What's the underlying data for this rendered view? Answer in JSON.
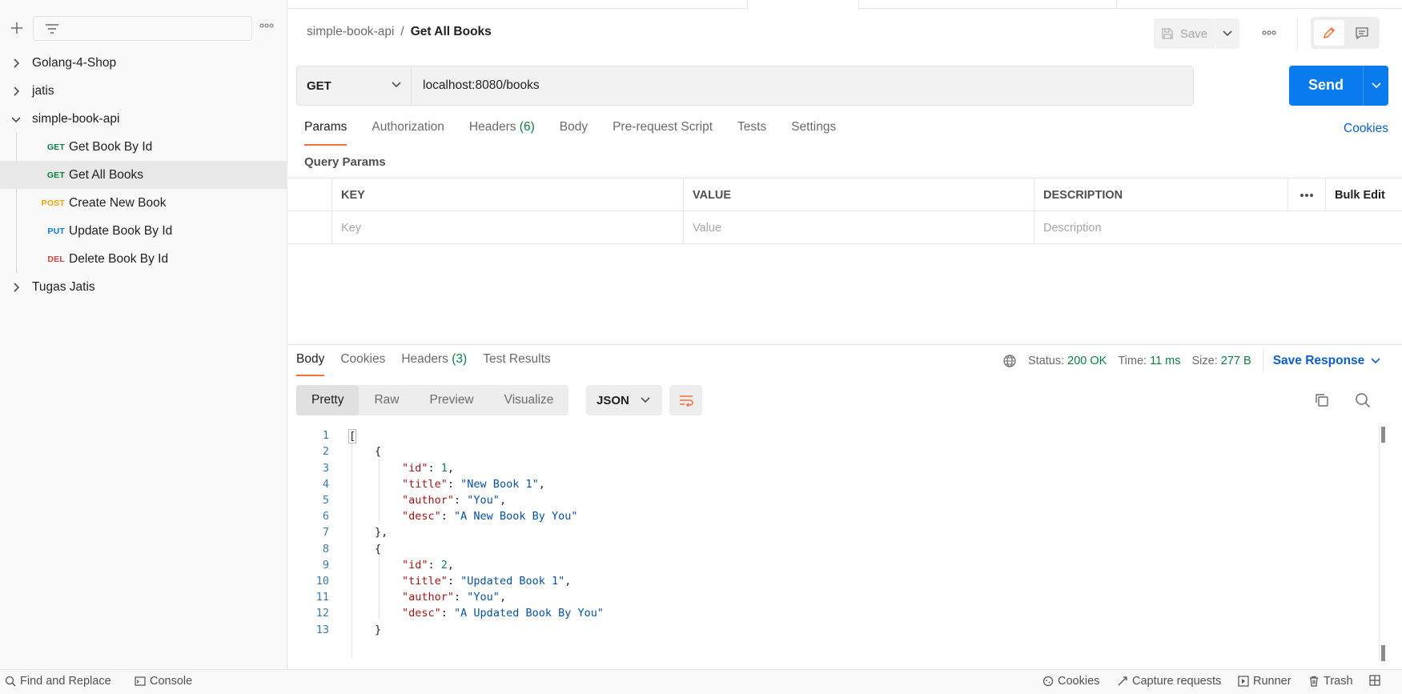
{
  "sidebar": {
    "collections": [
      {
        "label": "Golang-4-Shop"
      },
      {
        "label": "jatis"
      },
      {
        "label": "simple-book-api"
      },
      {
        "label": "Tugas Jatis"
      }
    ],
    "requests": [
      {
        "method": "GET",
        "label": "Get Book By Id",
        "color": "#0a7f3f"
      },
      {
        "method": "GET",
        "label": "Get All Books",
        "color": "#0a7f3f"
      },
      {
        "method": "POST",
        "label": "Create New Book",
        "color": "#f2a007"
      },
      {
        "method": "PUT",
        "label": "Update Book By Id",
        "color": "#097bed"
      },
      {
        "method": "DEL",
        "label": "Delete Book By Id",
        "color": "#d93f3c"
      }
    ]
  },
  "header": {
    "breadcrumb_parent": "simple-book-api",
    "breadcrumb_sep": "/",
    "breadcrumb_current": "Get All Books",
    "save_label": "Save"
  },
  "request": {
    "method": "GET",
    "url": "localhost:8080/books",
    "send_label": "Send",
    "tabs": [
      {
        "label": "Params"
      },
      {
        "label": "Authorization"
      },
      {
        "label": "Headers",
        "count": "(6)"
      },
      {
        "label": "Body"
      },
      {
        "label": "Pre-request Script"
      },
      {
        "label": "Tests"
      },
      {
        "label": "Settings"
      }
    ],
    "cookies_label": "Cookies",
    "query_params_title": "Query Params",
    "columns": {
      "key": "KEY",
      "value": "VALUE",
      "description": "DESCRIPTION",
      "bulk_edit": "Bulk Edit"
    },
    "placeholders": {
      "key": "Key",
      "value": "Value",
      "description": "Description"
    }
  },
  "response": {
    "tabs": [
      {
        "label": "Body"
      },
      {
        "label": "Cookies"
      },
      {
        "label": "Headers",
        "count": "(3)"
      },
      {
        "label": "Test Results"
      }
    ],
    "status_label": "Status:",
    "status_value": "200 OK",
    "time_label": "Time:",
    "time_value": "11 ms",
    "size_label": "Size:",
    "size_value": "277 B",
    "save_response_label": "Save Response",
    "views": [
      {
        "label": "Pretty"
      },
      {
        "label": "Raw"
      },
      {
        "label": "Preview"
      },
      {
        "label": "Visualize"
      }
    ],
    "format": "JSON",
    "lines": [
      "1",
      "2",
      "3",
      "4",
      "5",
      "6",
      "7",
      "8",
      "9",
      "10",
      "11",
      "12",
      "13"
    ],
    "code": {
      "open_array": "[",
      "open_obj": "{",
      "close_obj_comma": "},",
      "close_obj": "}",
      "k_id": "\"id\"",
      "k_title": "\"title\"",
      "k_author": "\"author\"",
      "k_desc": "\"desc\"",
      "colon": ": ",
      "comma": ",",
      "b1_id": "1",
      "b1_title": "\"New Book 1\"",
      "b1_author": "\"You\"",
      "b1_desc": "\"A New Book By You\"",
      "b2_id": "2",
      "b2_title": "\"Updated Book 1\"",
      "b2_author": "\"You\"",
      "b2_desc": "\"A Updated Book By You\""
    }
  },
  "footer": {
    "find_replace": "Find and Replace",
    "console": "Console",
    "cookies": "Cookies",
    "capture": "Capture requests",
    "runner": "Runner",
    "trash": "Trash"
  },
  "colors": {
    "accent": "#ff6c37",
    "primary": "#097bed",
    "success": "#0a7f3f"
  }
}
